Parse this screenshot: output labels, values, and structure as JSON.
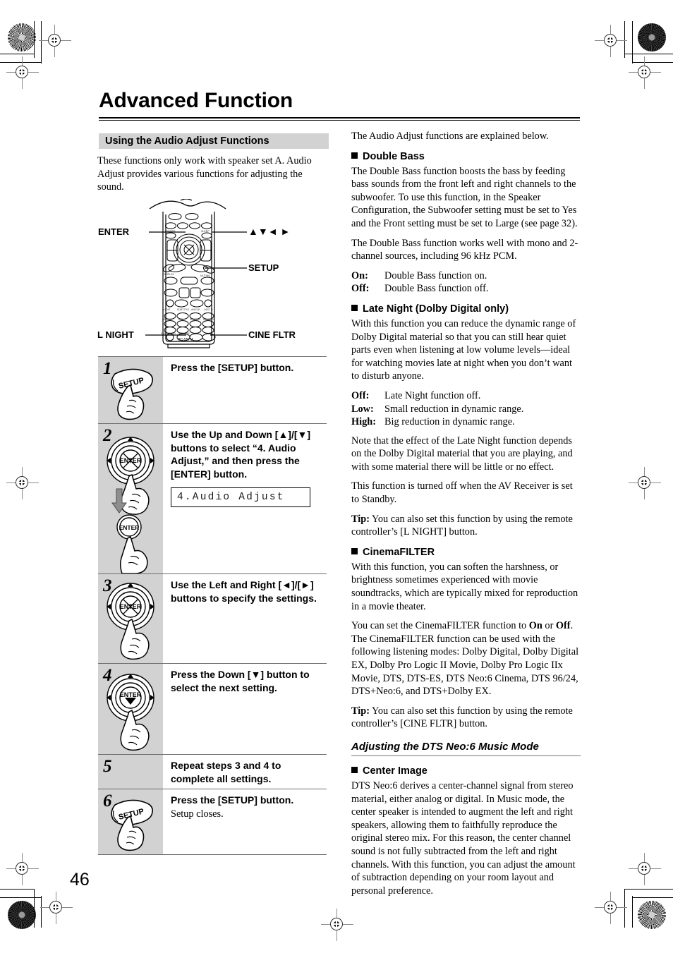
{
  "page": {
    "title": "Advanced Function",
    "number": "46"
  },
  "left_column": {
    "section_heading": "Using the Audio Adjust Functions",
    "intro": "These functions only work with speaker set A. Audio Adjust provides various functions for adjusting the sound.",
    "remote_figure": {
      "model_label": "RC-557M",
      "callouts": {
        "enter": "ENTER",
        "arrows": "▲▼◄ ►",
        "setup": "SETUP",
        "l_night": "L NIGHT",
        "cine_fltr": "CINE FLTR"
      }
    },
    "steps": [
      {
        "num": "1",
        "title": "Press the [SETUP] button.",
        "sub": "",
        "icon": "setup-button-press-icon",
        "lcd": ""
      },
      {
        "num": "2",
        "title": "Use the Up and Down [▲]/[▼] buttons to select “4. Audio Adjust,” and then press the [ENTER] button.",
        "sub": "",
        "icon": "navigation-wheel-down-then-enter-icon",
        "lcd": "4.Audio Adjust"
      },
      {
        "num": "3",
        "title": "Use the Left and Right [◄]/[►] buttons to specify the settings.",
        "sub": "",
        "icon": "navigation-wheel-left-right-icon",
        "lcd": ""
      },
      {
        "num": "4",
        "title": "Press the Down [▼] button to select the next setting.",
        "sub": "",
        "icon": "navigation-wheel-down-icon",
        "lcd": ""
      },
      {
        "num": "5",
        "title": "Repeat steps 3 and 4 to complete all settings.",
        "sub": "",
        "icon": "",
        "lcd": ""
      },
      {
        "num": "6",
        "title": "Press the [SETUP] button.",
        "sub": "Setup closes.",
        "icon": "setup-button-press-icon",
        "lcd": ""
      }
    ]
  },
  "right_column": {
    "lead": "The Audio Adjust functions are explained below.",
    "double_bass": {
      "heading": "Double Bass",
      "para1": "The Double Bass function boosts the bass by feeding bass sounds from the front left and right channels to the subwoofer. To use this function, in the Speaker Configuration, the Subwoofer setting must be set to Yes and the Front setting must be set to Large (see page 32).",
      "para2": "The Double Bass function works well with mono and 2-channel sources, including 96 kHz PCM.",
      "options": [
        {
          "term": "On:",
          "desc": "Double Bass function on."
        },
        {
          "term": "Off:",
          "desc": "Double Bass function off."
        }
      ]
    },
    "late_night": {
      "heading": "Late Night (Dolby Digital only)",
      "para1": "With this function you can reduce the dynamic range of Dolby Digital material so that you can still hear quiet parts even when listening at low volume levels—ideal for watching movies late at night when you don’t want to disturb anyone.",
      "options": [
        {
          "term": "Off:",
          "desc": "Late Night function off."
        },
        {
          "term": "Low:",
          "desc": "Small reduction in dynamic range."
        },
        {
          "term": "High:",
          "desc": "Big reduction in dynamic range."
        }
      ],
      "para2": "Note that the effect of the Late Night function depends on the Dolby Digital material that you are playing, and with some material there will be little or no effect.",
      "para3": "This function is turned off when the AV Receiver is set to Standby.",
      "tip_label": "Tip:",
      "tip": " You can also set this function by using the remote controller’s [L NIGHT] button."
    },
    "cinema_filter": {
      "heading": "CinemaFILTER",
      "para1": "With this function, you can soften the harshness, or brightness sometimes experienced with movie soundtracks, which are typically mixed for reproduction in a movie theater.",
      "para2_a": "You can set the CinemaFILTER function to ",
      "para2_on": "On",
      "para2_b": " or ",
      "para2_off": "Off",
      "para2_c": ". The CinemaFILTER function can be used with the following listening modes: Dolby Digital, Dolby Digital EX, Dolby Pro Logic II Movie, Dolby Pro Logic IIx Movie, DTS, DTS-ES, DTS Neo:6 Cinema, DTS 96/24, DTS+Neo:6, and DTS+Dolby EX.",
      "tip_label": "Tip:",
      "tip": " You can also set this function by using the remote controller’s [CINE FLTR] button."
    },
    "dts_neo6": {
      "sub_title": "Adjusting the DTS Neo:6 Music Mode",
      "center_image": {
        "heading": "Center Image",
        "para1": "DTS Neo:6 derives a center-channel signal from stereo material, either analog or digital. In Music mode, the center speaker is intended to augment the left and right speakers, allowing them to faithfully reproduce the original stereo mix. For this reason, the center channel sound is not fully subtracted from the left and right channels. With this function, you can adjust the amount of subtraction depending on your room layout and personal preference."
      }
    }
  },
  "colors": {
    "section_heading_bg": "#d2d2d2",
    "step_left_bg": "#d2d2d2",
    "rule": "#6d6d6d",
    "text": "#000000"
  }
}
